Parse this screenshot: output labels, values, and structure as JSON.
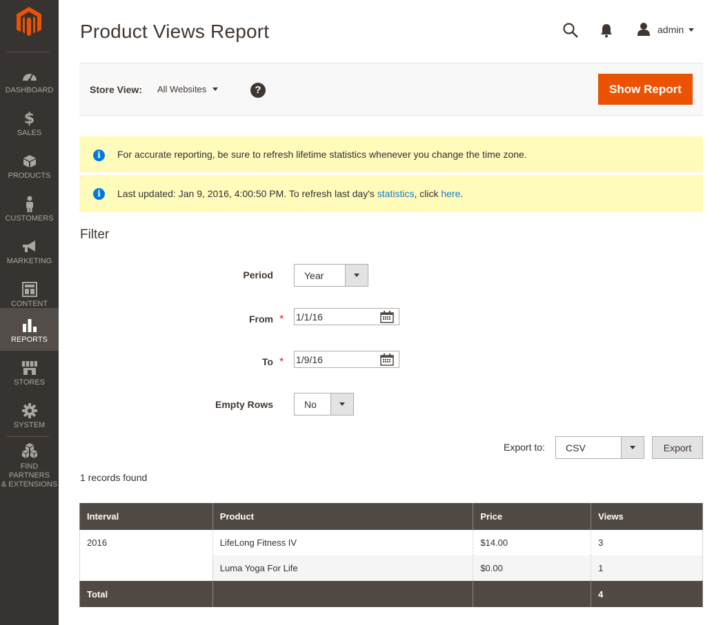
{
  "sidebar": {
    "logo_icon": "magento-logo-icon",
    "items": [
      {
        "label": "DASHBOARD",
        "icon": "dashboard-icon"
      },
      {
        "label": "SALES",
        "icon": "dollar-icon"
      },
      {
        "label": "PRODUCTS",
        "icon": "cube-icon"
      },
      {
        "label": "CUSTOMERS",
        "icon": "person-icon"
      },
      {
        "label": "MARKETING",
        "icon": "megaphone-icon"
      },
      {
        "label": "CONTENT",
        "icon": "layout-icon"
      },
      {
        "label": "REPORTS",
        "icon": "bar-chart-icon",
        "active": true
      },
      {
        "label": "STORES",
        "icon": "storefront-icon"
      },
      {
        "label": "SYSTEM",
        "icon": "gear-icon"
      },
      {
        "label_line1": "FIND PARTNERS",
        "label_line2": "& EXTENSIONS",
        "icon": "boxes-icon"
      }
    ]
  },
  "header": {
    "title": "Product Views Report",
    "user": "admin"
  },
  "store_bar": {
    "label": "Store View:",
    "selected": "All Websites",
    "help": "?",
    "action": "Show Report"
  },
  "messages": {
    "timezone": "For accurate reporting, be sure to refresh lifetime statistics whenever you change the time zone.",
    "updated_prefix": "Last updated: Jan 9, 2016, 4:00:50 PM. To refresh last day's ",
    "updated_link1": "statistics",
    "updated_mid": ", click ",
    "updated_link2": "here",
    "updated_suffix": "."
  },
  "filter": {
    "title": "Filter",
    "period_label": "Period",
    "period_value": "Year",
    "from_label": "From",
    "from_value": "1/1/16",
    "to_label": "To",
    "to_value": "1/9/16",
    "required_mark": "*",
    "empty_rows_label": "Empty Rows",
    "empty_rows_value": "No"
  },
  "export": {
    "label": "Export to:",
    "format": "CSV",
    "button": "Export"
  },
  "records": "1 records found",
  "table": {
    "headers": [
      "Interval",
      "Product",
      "Price",
      "Views"
    ],
    "rows": [
      {
        "interval": "2016",
        "product": "LifeLong Fitness IV",
        "price": "$14.00",
        "views": "3"
      },
      {
        "interval": "",
        "product": "Luma Yoga For Life",
        "price": "$0.00",
        "views": "1"
      }
    ],
    "total_label": "Total",
    "total_views": "4"
  },
  "colors": {
    "sidebar_bg": "#373330",
    "accent": "#eb5202",
    "table_header": "#514943",
    "notice_bg": "#fffbbb",
    "link": "#1979c3"
  }
}
